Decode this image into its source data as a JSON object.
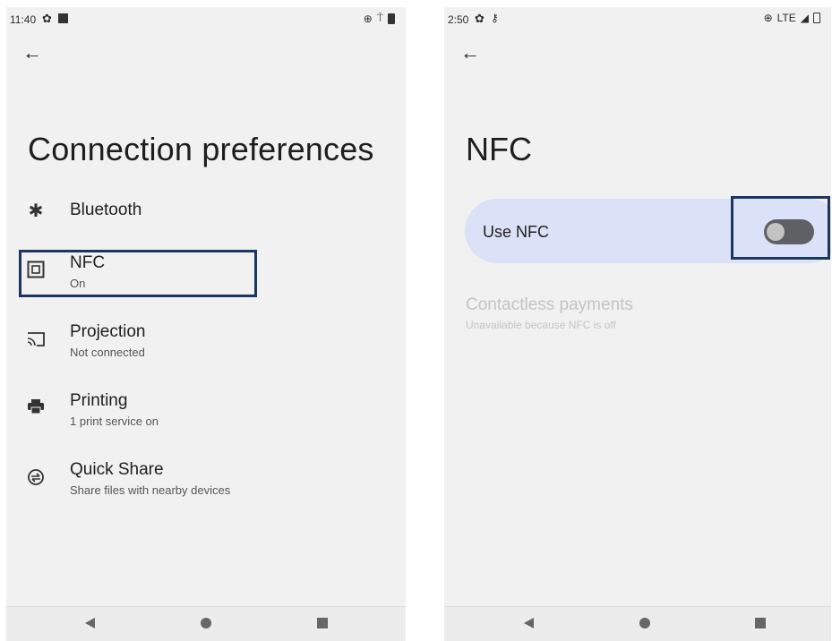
{
  "left": {
    "status": {
      "time": "11:40"
    },
    "title": "Connection preferences",
    "items": [
      {
        "label": "Bluetooth",
        "summary": ""
      },
      {
        "label": "NFC",
        "summary": "On"
      },
      {
        "label": "Projection",
        "summary": "Not connected"
      },
      {
        "label": "Printing",
        "summary": "1 print service on"
      },
      {
        "label": "Quick Share",
        "summary": "Share files with nearby devices"
      }
    ]
  },
  "right": {
    "status": {
      "time": "2:50",
      "network": "LTE"
    },
    "title": "NFC",
    "use_nfc_label": "Use NFC",
    "use_nfc_enabled": false,
    "contactless": {
      "label": "Contactless payments",
      "summary": "Unavailable because NFC is off"
    }
  },
  "colors": {
    "highlight": "#1b375f",
    "card": "#dbe1f6",
    "toggle_off": "#5f6063"
  }
}
